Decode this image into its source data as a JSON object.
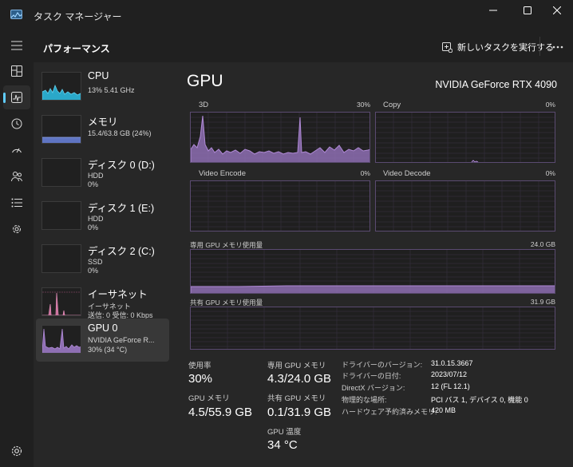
{
  "window": {
    "title": "タスク マネージャー"
  },
  "header": {
    "page_title": "パフォーマンス",
    "run_new_task": "新しいタスクを実行する"
  },
  "nav": {
    "items": [
      {
        "icon": "hamburger-icon"
      },
      {
        "icon": "processes-icon"
      },
      {
        "icon": "performance-icon",
        "active": true
      },
      {
        "icon": "app-history-icon"
      },
      {
        "icon": "startup-apps-icon"
      },
      {
        "icon": "users-icon"
      },
      {
        "icon": "details-icon"
      },
      {
        "icon": "services-icon"
      }
    ],
    "settings_icon": "gear-icon"
  },
  "devices": [
    {
      "name": "CPU",
      "line1": "13%  5.41 GHz",
      "line2": "",
      "selected": false
    },
    {
      "name": "メモリ",
      "line1": "15.4/63.8 GB (24%)",
      "line2": "",
      "selected": false
    },
    {
      "name": "ディスク 0 (D:)",
      "line1": "HDD",
      "line2": "0%",
      "selected": false
    },
    {
      "name": "ディスク 1 (E:)",
      "line1": "HDD",
      "line2": "0%",
      "selected": false
    },
    {
      "name": "ディスク 2 (C:)",
      "line1": "SSD",
      "line2": "0%",
      "selected": false
    },
    {
      "name": "イーサネット",
      "line1": "イーサネット",
      "line2": "送信: 0 受信: 0 Kbps",
      "selected": false
    },
    {
      "name": "GPU 0",
      "line1": "NVIDIA GeForce R...",
      "line2": "30%  (34 °C)",
      "selected": true
    }
  ],
  "gpu": {
    "title": "GPU",
    "model": "NVIDIA GeForce RTX 4090",
    "engines": [
      {
        "label": "3D",
        "percent": "30%"
      },
      {
        "label": "Copy",
        "percent": "0%"
      },
      {
        "label": "Video Encode",
        "percent": "0%"
      },
      {
        "label": "Video Decode",
        "percent": "0%"
      }
    ],
    "dedicated_memory_graph": {
      "label": "専用 GPU メモリ使用量",
      "max": "24.0 GB",
      "fill_fraction": 0.18
    },
    "shared_memory_graph": {
      "label": "共有 GPU メモリ使用量",
      "max": "31.9 GB",
      "fill_fraction": 0.003
    },
    "stats": {
      "utilization_label": "使用率",
      "utilization_value": "30%",
      "dedicated_label": "専用 GPU メモリ",
      "dedicated_value": "4.3/24.0 GB",
      "gpu_memory_label": "GPU メモリ",
      "gpu_memory_value": "4.5/55.9 GB",
      "shared_label": "共有 GPU メモリ",
      "shared_value": "0.1/31.9 GB",
      "temp_label": "GPU 温度",
      "temp_value": "34 °C"
    },
    "details": [
      {
        "key": "ドライバーのバージョン:",
        "value": "31.0.15.3667"
      },
      {
        "key": "ドライバーの日付:",
        "value": "2023/07/12"
      },
      {
        "key": "DirectX バージョン:",
        "value": "12 (FL 12.1)"
      },
      {
        "key": "物理的な場所:",
        "value": "PCI バス 1, デバイス 0, 機能 0"
      },
      {
        "key": "ハードウェア予約済みメモリ:",
        "value": "420 MB"
      }
    ]
  },
  "colors": {
    "gpu_fill": "#8e6fb3",
    "gpu_line": "#b08ad6",
    "cpu_fill": "#2aa8c9",
    "memory_fill": "#5f74c2",
    "accent": "#60cdff"
  }
}
